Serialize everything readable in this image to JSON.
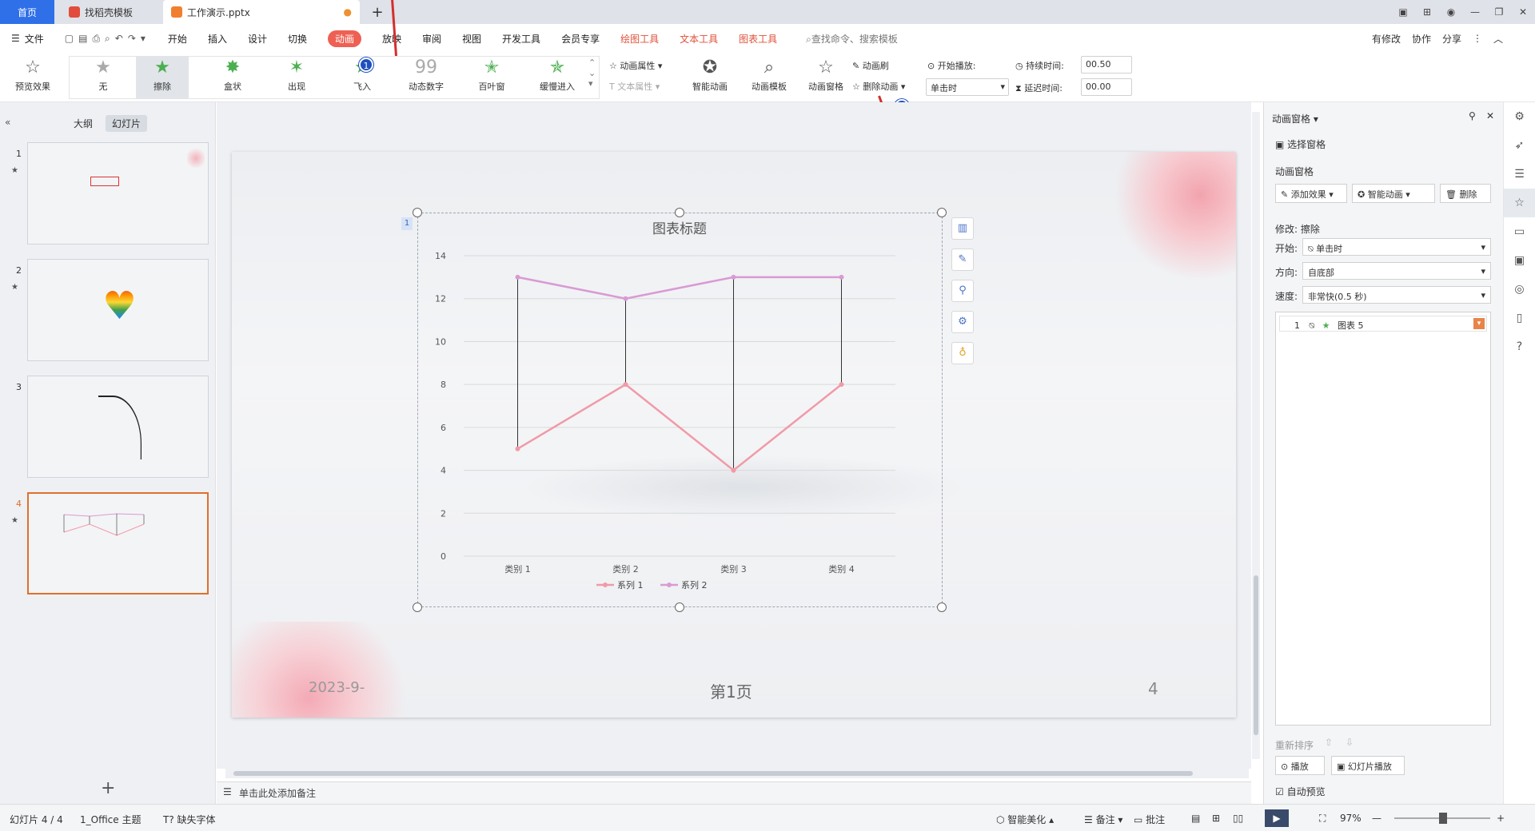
{
  "tabs": {
    "home": "首页",
    "template": "找稻壳模板",
    "file": "工作演示.pptx",
    "plus": "+"
  },
  "menu": {
    "file": "文件",
    "items": [
      "开始",
      "插入",
      "设计",
      "切换",
      "动画",
      "放映",
      "审阅",
      "视图",
      "开发工具",
      "会员专享"
    ],
    "context": [
      "绘图工具",
      "文本工具",
      "图表工具"
    ],
    "search": "查找命令、搜索模板",
    "right": [
      "有修改",
      "协作",
      "分享"
    ]
  },
  "ribbon": {
    "preview": "预览效果",
    "effects": [
      "无",
      "擦除",
      "盒状",
      "出现",
      "飞入",
      "动态数字",
      "百叶窗",
      "缓慢进入"
    ],
    "anim_props": "动画属性",
    "text_props": "文本属性",
    "smart_anim": "智能动画",
    "anim_template": "动画模板",
    "anim_pane": "动画窗格",
    "anim_brush": "动画刷",
    "delete_anim": "删除动画",
    "start_play": "开始播放:",
    "start_value": "单击时",
    "duration_label": "持续时间:",
    "duration": "00.50",
    "delay_label": "延迟时间:",
    "delay": "00.00"
  },
  "badges": [
    "1",
    "2"
  ],
  "left_panel": {
    "tab_outline": "大纲",
    "tab_slides": "幻灯片",
    "slides": [
      "1",
      "2",
      "3",
      "4"
    ]
  },
  "slide": {
    "date": "2023-9-",
    "page_label": "第1页",
    "page_num": "4",
    "chart_badge": "1"
  },
  "chart_data": {
    "type": "line",
    "title": "图表标题",
    "categories": [
      "类别 1",
      "类别 2",
      "类别 3",
      "类别 4"
    ],
    "series": [
      {
        "name": "系列 1",
        "values": [
          5,
          8,
          4,
          8
        ],
        "color": "#f09aa8"
      },
      {
        "name": "系列 2",
        "values": [
          13,
          12,
          13,
          13
        ],
        "color": "#d99ad3"
      }
    ],
    "ylim": [
      0,
      14
    ],
    "yticks": [
      "0",
      "2",
      "4",
      "6",
      "8",
      "10",
      "12",
      "14"
    ],
    "gridlines": true,
    "hi_lo_lines": true,
    "legend": "bottom"
  },
  "notes_placeholder": "单击此处添加备注",
  "right_panel": {
    "title": "动画窗格",
    "select_pane": "选择窗格",
    "section": "动画窗格",
    "add_effect": "添加效果",
    "smart_anim": "智能动画",
    "delete": "删除",
    "modify": "修改: 擦除",
    "start_label": "开始:",
    "start_value": "单击时",
    "direction_label": "方向:",
    "direction_value": "自底部",
    "speed_label": "速度:",
    "speed_value": "非常快(0.5 秒)",
    "list_item": {
      "index": "1",
      "name": "图表 5"
    },
    "reorder": "重新排序",
    "play": "播放",
    "slideshow": "幻灯片播放",
    "autopreview": "自动预览"
  },
  "status": {
    "slide": "幻灯片 4 / 4",
    "theme": "1_Office 主题",
    "missing_font": "缺失字体",
    "beautify": "智能美化",
    "notes": "备注",
    "comments": "批注",
    "zoom": "97%"
  }
}
